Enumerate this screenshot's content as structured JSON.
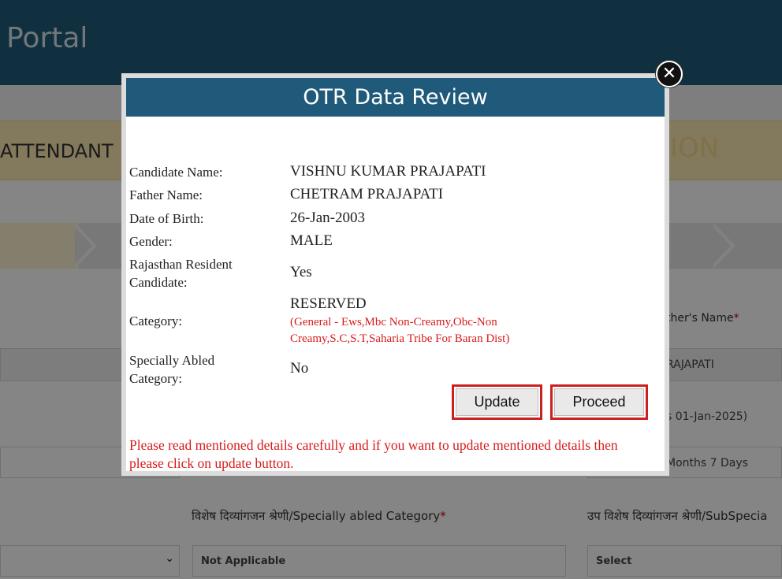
{
  "page": {
    "portal_title": "Portal",
    "post_name": "ATTENDANT",
    "post_right_fragment": "ION",
    "father_name_label": "ther's Name",
    "required_mark": "*",
    "father_name_value": "RAJAPATI",
    "age_as_on": "s 01-Jan-2025)",
    "age_value": "Months 7 Days",
    "specially_abled_label": "विशेष दिव्यांगजन श्रेणी/Specially abled Category",
    "specially_abled_value": "Not Applicable",
    "sub_category_label": "उप विशेष दिव्यांगजन श्रेणी/SubSpecia",
    "sub_category_value": "Select"
  },
  "modal": {
    "title": "OTR Data Review",
    "close_symbol": "✕",
    "rows": [
      {
        "label": "Candidate Name:",
        "value": "VISHNU KUMAR PRAJAPATI"
      },
      {
        "label": "Father Name:",
        "value": "CHETRAM PRAJAPATI"
      },
      {
        "label": "Date of Birth:",
        "value": "26-Jan-2003"
      },
      {
        "label": "Gender:",
        "value": "MALE"
      },
      {
        "label": "Rajasthan Resident Candidate:",
        "value": "Yes"
      },
      {
        "label": "Category:",
        "value": "RESERVED"
      },
      {
        "label": "Specially Abled Category:",
        "value": "No"
      }
    ],
    "category_note": "(General - Ews,Mbc Non-Creamy,Obc-Non Creamy,S.C,S.T,Saharia Tribe For Baran Dist)",
    "update_label": "Update",
    "proceed_label": "Proceed",
    "notice": "Please read mentioned details carefully and if you want to update mentioned details then please click on update button."
  },
  "colors": {
    "header": "#1f5a7a",
    "accent_red": "#cc2020",
    "note_red": "#d81b1b"
  }
}
